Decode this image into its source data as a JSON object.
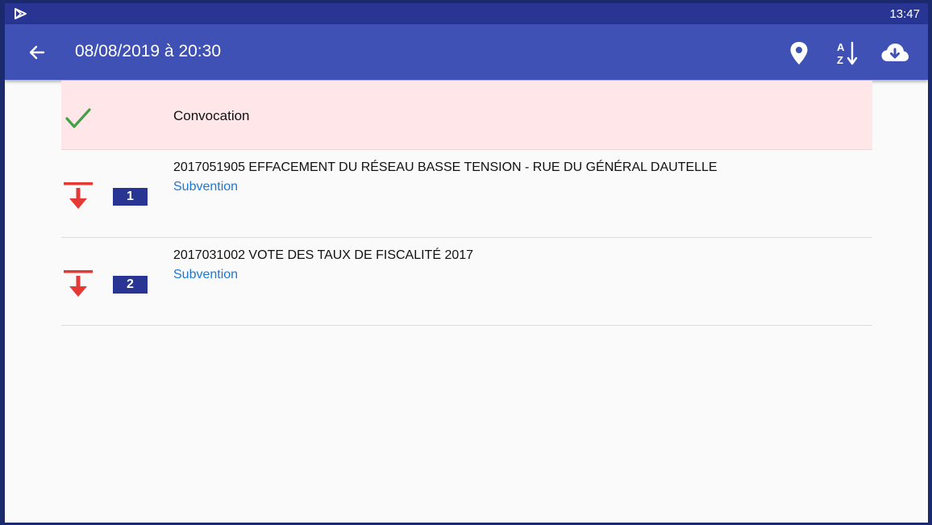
{
  "status_bar": {
    "time": "13:47",
    "notification_icon": "play-store-icon"
  },
  "app_bar": {
    "title": "08/08/2019 à 20:30",
    "actions": [
      "location-pin-icon",
      "sort-az-icon",
      "cloud-download-icon"
    ]
  },
  "colors": {
    "status_bar": "#283593",
    "app_bar": "#3f51b5",
    "convocation_bg": "#ffe6e9",
    "check": "#43a047",
    "vote_arrow": "#e53935",
    "number_badge": "#283593",
    "type_link": "#1e78d2"
  },
  "convocation": {
    "label": "Convocation",
    "icon": "check-icon"
  },
  "items": [
    {
      "number": "1",
      "subject": "2017051905 EFFACEMENT DU RÉSEAU BASSE TENSION - RUE DU GÉNÉRAL DAUTELLE",
      "type": "Subvention",
      "icon": "vote-down-icon"
    },
    {
      "number": "2",
      "subject": "2017031002 VOTE DES TAUX DE FISCALITÉ 2017",
      "type": "Subvention",
      "icon": "vote-down-icon"
    }
  ]
}
